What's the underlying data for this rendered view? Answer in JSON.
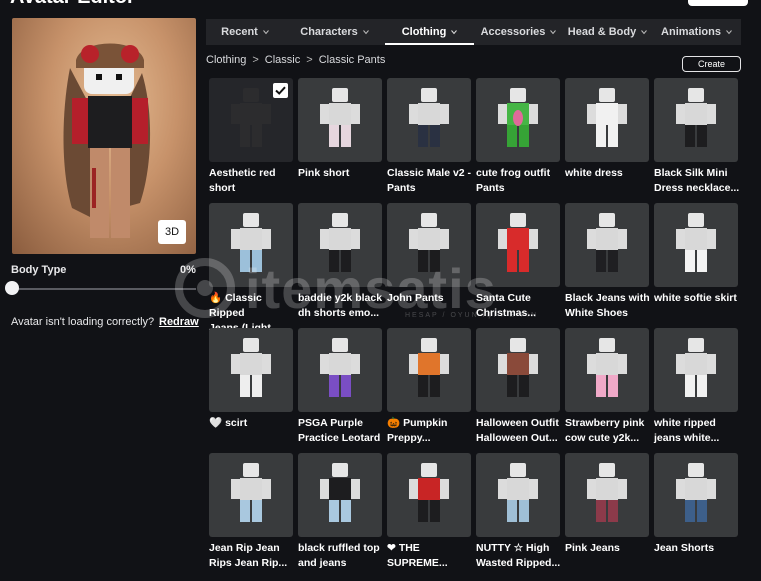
{
  "page": {
    "title": "Avatar Editor"
  },
  "preview": {
    "button_3d": "3D"
  },
  "body_type": {
    "label": "Body Type",
    "value_text": "0%",
    "value": 0
  },
  "loading": {
    "text": "Avatar isn't loading correctly?",
    "link": "Redraw"
  },
  "tabs": [
    {
      "label": "Recent",
      "active": false
    },
    {
      "label": "Characters",
      "active": false
    },
    {
      "label": "Clothing",
      "active": true
    },
    {
      "label": "Accessories",
      "active": false
    },
    {
      "label": "Head & Body",
      "active": false
    },
    {
      "label": "Animations",
      "active": false
    }
  ],
  "breadcrumb": {
    "level1": "Clothing",
    "level2": "Classic",
    "level3": "Classic Pants",
    "sep": ">"
  },
  "create_label": "Create",
  "items": [
    {
      "line1": "Aesthetic red",
      "line2": "short",
      "pants": "#2c2c2e",
      "shirt": "#2c2c2e",
      "skin": "#2c2c2e",
      "dark": true,
      "selected": true
    },
    {
      "line1": "Pink short",
      "line2": "",
      "pants": "#e6d6de",
      "shirt": "#d8d8d8"
    },
    {
      "line1": "Classic Male v2 -",
      "line2": "Pants",
      "pants": "#2a3142",
      "shirt": "#d8d8d8"
    },
    {
      "line1": "cute frog outfit",
      "line2": "Pants",
      "pants": "#36a336",
      "shirt": "#45b545",
      "accent": "#e06a9a"
    },
    {
      "line1": "white dress",
      "line2": "",
      "pants": "#f1f1f1",
      "shirt": "#f1f1f1"
    },
    {
      "line1": "Black Silk Mini",
      "line2": "Dress necklace...",
      "pants": "#1d1d1f",
      "shirt": "#d8d8d8"
    },
    {
      "line1": "Classic Ripped",
      "line2": "Jeans (Light...",
      "prefix": "🔥",
      "pants": "#9cc0da",
      "shirt": "#d8d8d8"
    },
    {
      "line1": "baddie y2k black",
      "line2": "dh shorts emo...",
      "pants": "#1d1d1f",
      "shirt": "#d8d8d8"
    },
    {
      "line1": "John Pants",
      "line2": "",
      "pants": "#1c1c1e",
      "shirt": "#d8d8d8"
    },
    {
      "line1": "Santa Cute",
      "line2": "Christmas...",
      "pants": "#d82b2b",
      "shirt": "#d82b2b"
    },
    {
      "line1": "Black Jeans with",
      "line2": "White Shoes",
      "pants": "#1f1f22",
      "shirt": "#d8d8d8"
    },
    {
      "line1": "white softie skirt",
      "line2": "",
      "pants": "#f3f3f3",
      "shirt": "#d8d8d8"
    },
    {
      "line1": "scirt",
      "line2": "",
      "prefix": "🤍",
      "pants": "#eeeeee",
      "shirt": "#d8d8d8"
    },
    {
      "line1": "PSGA Purple",
      "line2": "Practice Leotard",
      "pants": "#7a4ec4",
      "shirt": "#d8d8d8"
    },
    {
      "line1": "Pumpkin",
      "line2": "Preppy...",
      "prefix": "🎃",
      "pants": "#1d1d1f",
      "shirt": "#e0752b"
    },
    {
      "line1": "Halloween Outfit",
      "line2": "Halloween Out...",
      "pants": "#1d1d1f",
      "shirt": "#8a4a3a"
    },
    {
      "line1": "Strawberry pink",
      "line2": "cow cute y2k...",
      "pants": "#f0a9c8",
      "shirt": "#d8d8d8"
    },
    {
      "line1": "white ripped",
      "line2": "jeans white...",
      "pants": "#f1f1f1",
      "shirt": "#d8d8d8"
    },
    {
      "line1": "Jean Rip Jean",
      "line2": "Rips Jean Rip...",
      "pants": "#a9c8df",
      "shirt": "#d8d8d8"
    },
    {
      "line1": "black ruffled top",
      "line2": "and jeans",
      "pants": "#a9c8df",
      "shirt": "#1d1d1f"
    },
    {
      "line1": "THE",
      "line2": "SUPREME...",
      "prefix": "❤",
      "pants": "#1d1d1f",
      "shirt": "#c82525"
    },
    {
      "line1": "NUTTY ☆ High",
      "line2": "Wasted Ripped...",
      "pants": "#9fbfd6",
      "shirt": "#d8d8d8"
    },
    {
      "line1": "Pink Jeans",
      "line2": "",
      "pants": "#8c3a4a",
      "shirt": "#d8d8d8"
    },
    {
      "line1": "Jean Shorts",
      "line2": "",
      "pants": "#3d5f8a",
      "shirt": "#d8d8d8"
    }
  ],
  "watermark": {
    "text": "itemsatis",
    "sub": "HESAP / OYUN İÇİ / E-PIN"
  }
}
